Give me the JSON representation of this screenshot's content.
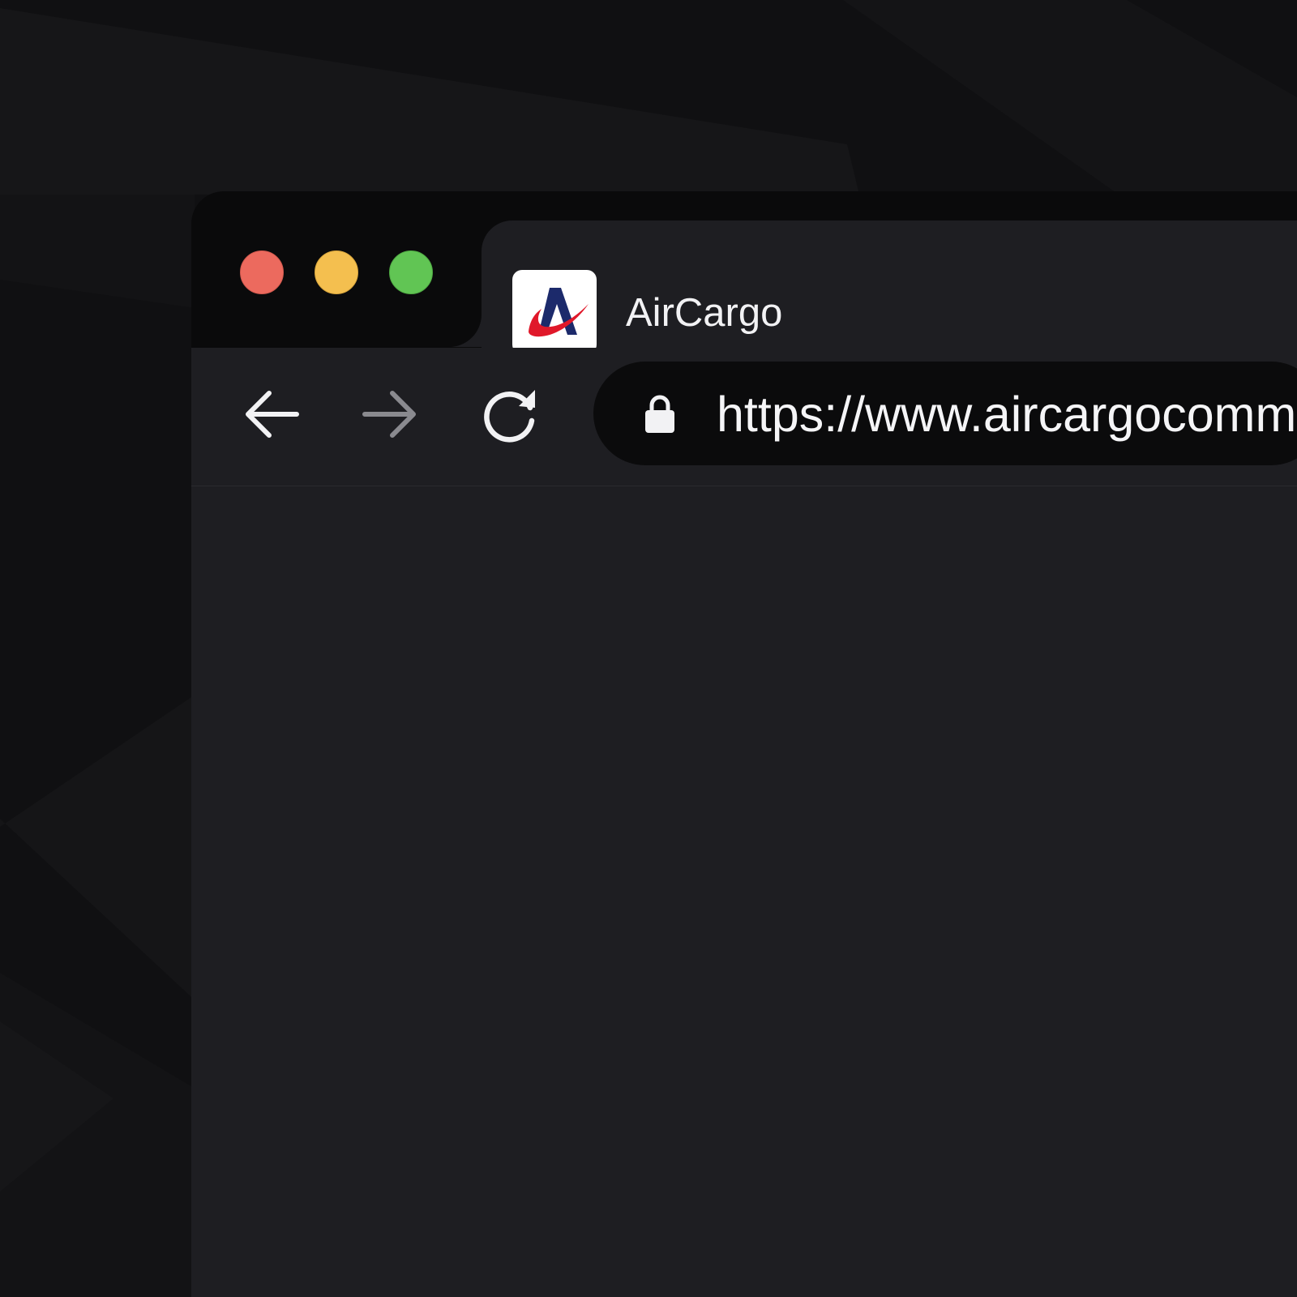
{
  "window": {
    "controls": {
      "close_color": "#ec6a5e",
      "minimize_color": "#f4bf4f",
      "maximize_color": "#61c554"
    }
  },
  "tab": {
    "title": "AirCargo",
    "favicon": "aircargo-logo-icon",
    "favicon_colors": {
      "letter": "#1c2a6b",
      "swoosh": "#e0182a"
    }
  },
  "toolbar": {
    "back_icon": "arrow-left-icon",
    "forward_icon": "arrow-right-icon",
    "reload_icon": "reload-icon",
    "forward_disabled": true
  },
  "address_bar": {
    "secure_icon": "lock-icon",
    "url": "https://www.aircargocomm"
  },
  "theme": {
    "background": "#101012",
    "chrome": "#0a0a0b",
    "surface": "#1e1e22",
    "text": "#f2f2f4",
    "muted_icon": "#8a8a8f"
  }
}
